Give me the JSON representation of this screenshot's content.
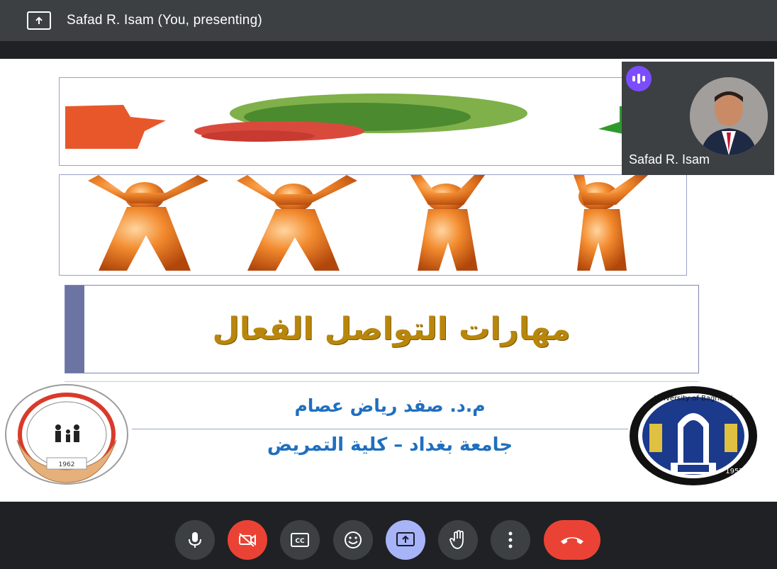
{
  "meeting": {
    "presenter_label": "Safad R. Isam (You, presenting)",
    "icons": {
      "presenting": "present-to-all-icon"
    }
  },
  "slide": {
    "title": "مهارات التواصل الفعال",
    "author_line": "م.د. صفد رياض عصام",
    "affiliation_line": "جامعة بغداد – كلية التمريض",
    "left_logo_year": "1962",
    "right_logo_text": "University of Baghdad",
    "right_logo_year": "1957"
  },
  "participant": {
    "name": "Safad R. Isam",
    "speaking_indicator": "audio-bars-icon",
    "accent": "#7c4dff"
  },
  "controls": {
    "items": [
      "mic-icon",
      "camera-off-icon",
      "captions-icon",
      "emoji-icon",
      "present-icon",
      "raise-hand-icon",
      "more-options-icon",
      "leave-call-icon"
    ],
    "colors": {
      "danger": "#ea4335",
      "active": "#a8b4f8",
      "neutral": "#3c4043"
    }
  }
}
